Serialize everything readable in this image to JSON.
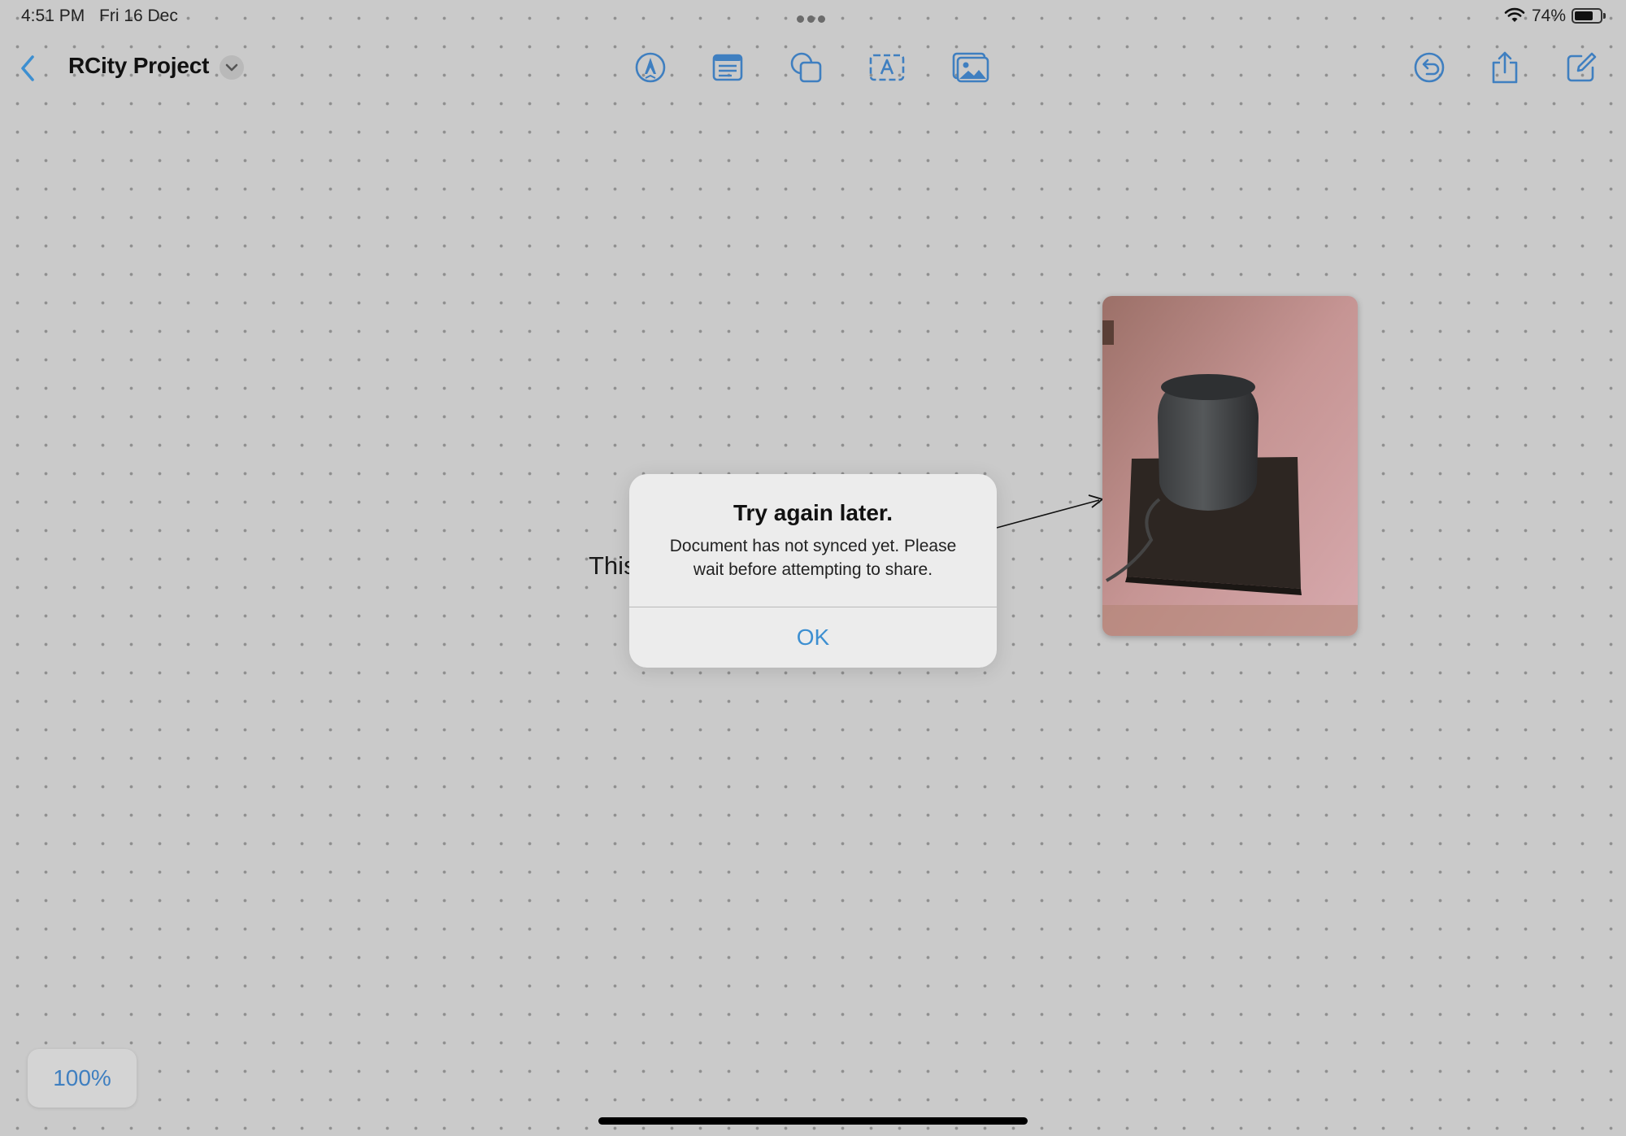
{
  "status_bar": {
    "time": "4:51 PM",
    "date": "Fri 16 Dec",
    "battery_percent": "74%",
    "battery_level": 0.74,
    "icons": [
      "wifi-icon",
      "battery-icon",
      "multitask-dots-icon"
    ]
  },
  "toolbar": {
    "title": "RCity Project",
    "icons": [
      "back-chevron-icon",
      "title-chevron-icon",
      "pen-tool-icon",
      "sticky-note-icon",
      "shapes-icon",
      "text-box-icon",
      "photo-icon",
      "undo-icon",
      "share-icon",
      "compose-icon"
    ]
  },
  "canvas": {
    "text_fragment": "This",
    "photo_icon": "homepod-photo"
  },
  "alert": {
    "title": "Try again later.",
    "message": "Document has not synced yet. Please wait before attempting to share.",
    "ok_label": "OK"
  },
  "zoom": {
    "label": "100%"
  },
  "colors": {
    "accent": "#3d8fd1",
    "icon_blue": "#3f7fc0",
    "background": "#cacaca"
  }
}
